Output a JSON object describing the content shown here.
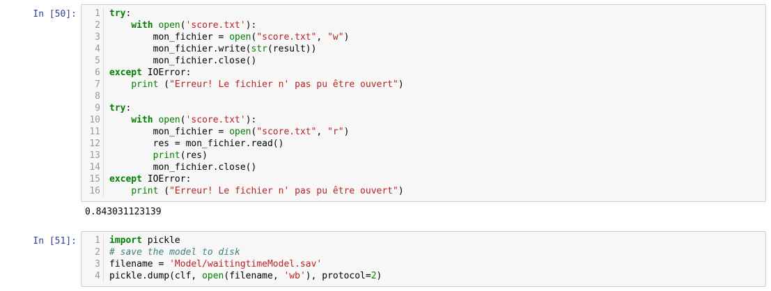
{
  "cells": [
    {
      "prompt": "In [50]:",
      "lines": [
        {
          "n": "1",
          "tokens": [
            [
              "kw",
              "try"
            ],
            [
              "plain",
              ":"
            ]
          ]
        },
        {
          "n": "2",
          "tokens": [
            [
              "plain",
              "    "
            ],
            [
              "kw",
              "with"
            ],
            [
              "plain",
              " "
            ],
            [
              "builtin",
              "open"
            ],
            [
              "plain",
              "("
            ],
            [
              "str",
              "'score.txt'"
            ],
            [
              "plain",
              "):"
            ]
          ]
        },
        {
          "n": "3",
          "tokens": [
            [
              "plain",
              "        mon_fichier = "
            ],
            [
              "builtin",
              "open"
            ],
            [
              "plain",
              "("
            ],
            [
              "str",
              "\"score.txt\""
            ],
            [
              "plain",
              ", "
            ],
            [
              "str",
              "\"w\""
            ],
            [
              "plain",
              ")"
            ]
          ]
        },
        {
          "n": "4",
          "tokens": [
            [
              "plain",
              "        mon_fichier.write("
            ],
            [
              "builtin",
              "str"
            ],
            [
              "plain",
              "(result))"
            ]
          ]
        },
        {
          "n": "5",
          "tokens": [
            [
              "plain",
              "        mon_fichier.close()"
            ]
          ]
        },
        {
          "n": "6",
          "tokens": [
            [
              "kw",
              "except"
            ],
            [
              "plain",
              " IOError:"
            ]
          ]
        },
        {
          "n": "7",
          "tokens": [
            [
              "plain",
              "    "
            ],
            [
              "builtin",
              "print"
            ],
            [
              "plain",
              " ("
            ],
            [
              "str",
              "\"Erreur! Le fichier n' pas pu être ouvert\""
            ],
            [
              "plain",
              ")"
            ]
          ]
        },
        {
          "n": "8",
          "tokens": [
            [
              "plain",
              ""
            ]
          ]
        },
        {
          "n": "9",
          "tokens": [
            [
              "kw",
              "try"
            ],
            [
              "plain",
              ":"
            ]
          ]
        },
        {
          "n": "10",
          "tokens": [
            [
              "plain",
              "    "
            ],
            [
              "kw",
              "with"
            ],
            [
              "plain",
              " "
            ],
            [
              "builtin",
              "open"
            ],
            [
              "plain",
              "("
            ],
            [
              "str",
              "'score.txt'"
            ],
            [
              "plain",
              "):"
            ]
          ]
        },
        {
          "n": "11",
          "tokens": [
            [
              "plain",
              "        mon_fichier = "
            ],
            [
              "builtin",
              "open"
            ],
            [
              "plain",
              "("
            ],
            [
              "str",
              "\"score.txt\""
            ],
            [
              "plain",
              ", "
            ],
            [
              "str",
              "\"r\""
            ],
            [
              "plain",
              ")"
            ]
          ]
        },
        {
          "n": "12",
          "tokens": [
            [
              "plain",
              "        res = mon_fichier.read()"
            ]
          ]
        },
        {
          "n": "13",
          "tokens": [
            [
              "plain",
              "        "
            ],
            [
              "builtin",
              "print"
            ],
            [
              "plain",
              "(res)"
            ]
          ]
        },
        {
          "n": "14",
          "tokens": [
            [
              "plain",
              "        mon_fichier.close()"
            ]
          ]
        },
        {
          "n": "15",
          "tokens": [
            [
              "kw",
              "except"
            ],
            [
              "plain",
              " IOError:"
            ]
          ]
        },
        {
          "n": "16",
          "tokens": [
            [
              "plain",
              "    "
            ],
            [
              "builtin",
              "print"
            ],
            [
              "plain",
              " ("
            ],
            [
              "str",
              "\"Erreur! Le fichier n' pas pu être ouvert\""
            ],
            [
              "plain",
              ")"
            ]
          ]
        }
      ],
      "output": "0.843031123139"
    },
    {
      "prompt": "In [51]:",
      "lines": [
        {
          "n": "1",
          "tokens": [
            [
              "kw",
              "import"
            ],
            [
              "plain",
              " pickle"
            ]
          ]
        },
        {
          "n": "2",
          "tokens": [
            [
              "comment",
              "# save the model to disk"
            ]
          ]
        },
        {
          "n": "3",
          "tokens": [
            [
              "plain",
              "filename = "
            ],
            [
              "str",
              "'Model/waitingtimeModel.sav'"
            ]
          ]
        },
        {
          "n": "4",
          "tokens": [
            [
              "plain",
              "pickle.dump(clf, "
            ],
            [
              "builtin",
              "open"
            ],
            [
              "plain",
              "(filename, "
            ],
            [
              "str",
              "'wb'"
            ],
            [
              "plain",
              "), protocol="
            ],
            [
              "num",
              "2"
            ],
            [
              "plain",
              ")"
            ]
          ]
        }
      ],
      "output": ""
    }
  ],
  "colors": {
    "prompt": "#303f9f",
    "keyword": "#008000",
    "string": "#ba2121",
    "comment": "#408080",
    "cell_background": "#f7f7f7",
    "cell_border": "#cfcfcf"
  }
}
